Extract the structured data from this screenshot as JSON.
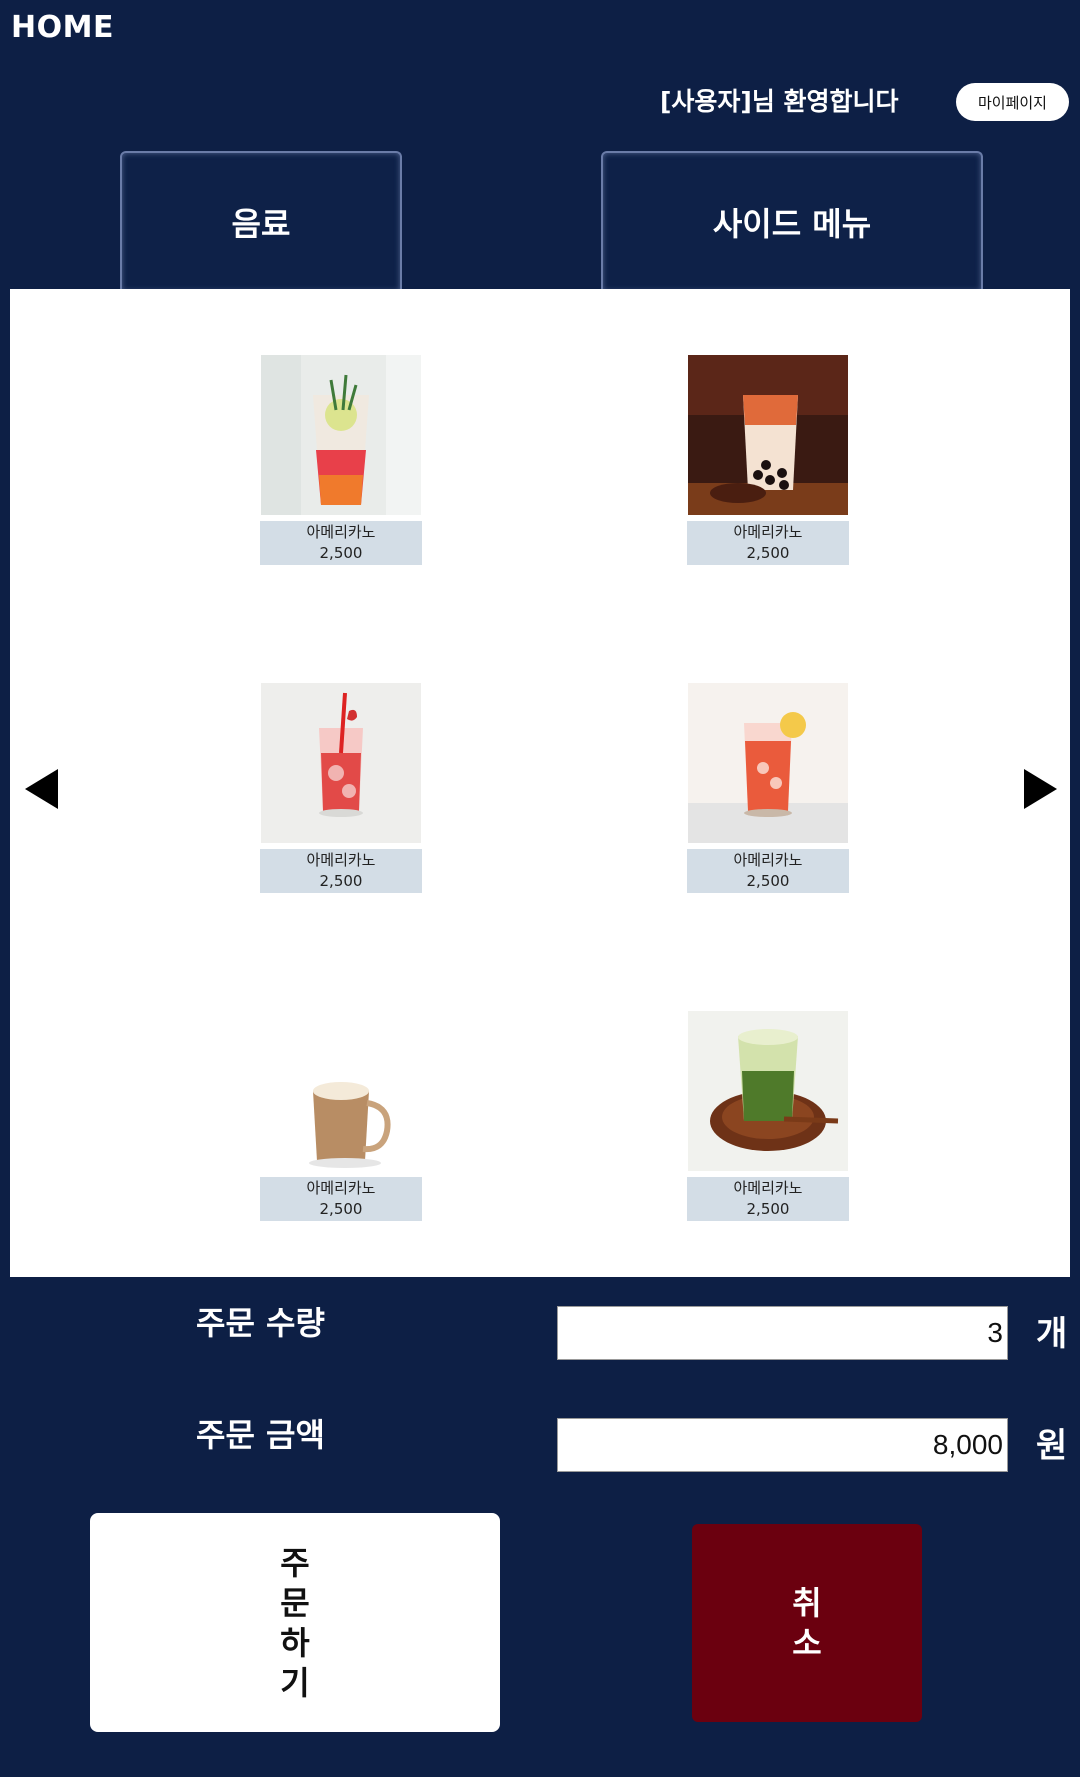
{
  "header": {
    "home": "HOME",
    "welcome": "[사용자]님 환영합니다",
    "mypage": "마이페이지"
  },
  "tabs": [
    {
      "label": "음료"
    },
    {
      "label": "사이드 메뉴"
    }
  ],
  "nav": {
    "prev_icon": "triangle-left-icon",
    "next_icon": "triangle-right-icon"
  },
  "items": [
    {
      "name": "아메리카노",
      "price": "2,500",
      "image": "rosemary-iced-tea-photo"
    },
    {
      "name": "아메리카노",
      "price": "2,500",
      "image": "bubble-milk-tea-photo"
    },
    {
      "name": "아메리카노",
      "price": "2,500",
      "image": "strawberry-soda-photo"
    },
    {
      "name": "아메리카노",
      "price": "2,500",
      "image": "lemon-iced-tea-photo"
    },
    {
      "name": "아메리카노",
      "price": "2,500",
      "image": "latte-mug-photo"
    },
    {
      "name": "아메리카노",
      "price": "2,500",
      "image": "matcha-latte-photo"
    }
  ],
  "order": {
    "qty_label": "주문 수량",
    "qty_value": "3",
    "qty_unit": "개",
    "amount_label": "주문 금액",
    "amount_value": "8,000",
    "amount_unit": "원"
  },
  "buttons": {
    "order": "주문하기",
    "cancel": "취소"
  },
  "colors": {
    "background": "#0d1f45",
    "caption_bg": "#d3dde6",
    "cancel_bg": "#6b000f"
  }
}
